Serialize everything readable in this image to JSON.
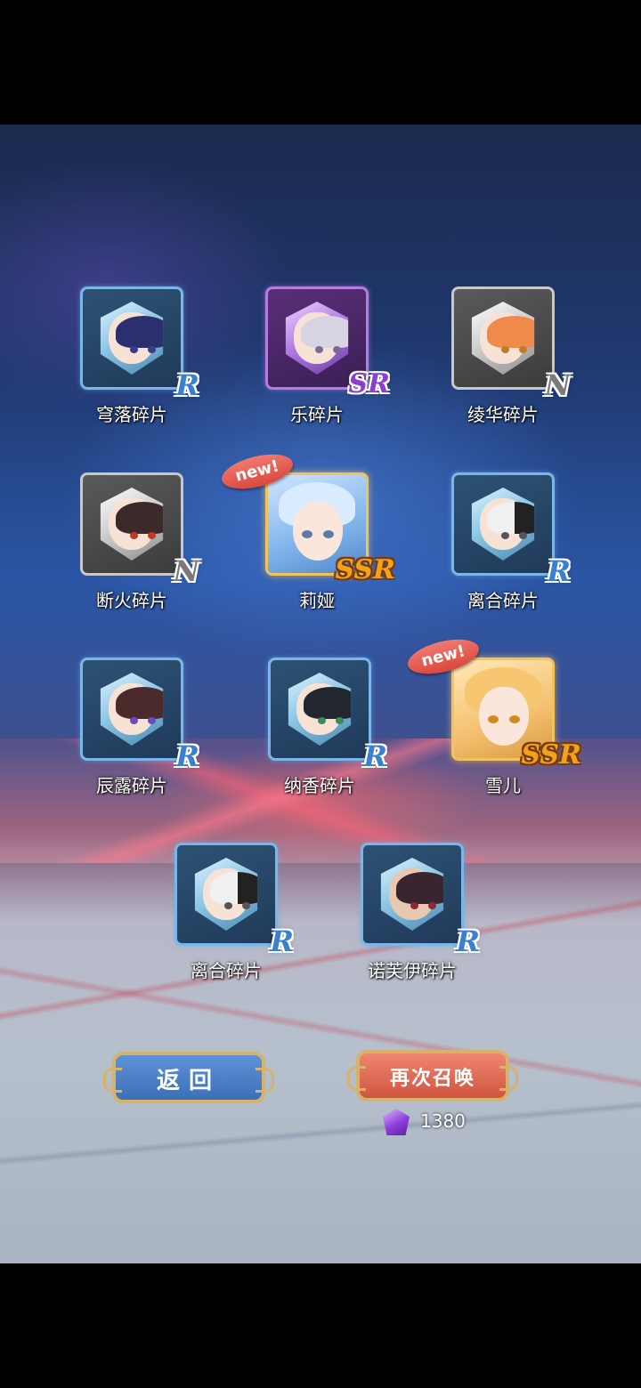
{
  "cards": [
    {
      "id": "c1",
      "label": "穹落碎片",
      "rarity": "R",
      "is_new": false
    },
    {
      "id": "c2",
      "label": "乐碎片",
      "rarity": "SR",
      "is_new": false
    },
    {
      "id": "c3",
      "label": "绫华碎片",
      "rarity": "N",
      "is_new": false
    },
    {
      "id": "c4",
      "label": "断火碎片",
      "rarity": "N",
      "is_new": false
    },
    {
      "id": "c5",
      "label": "莉娅",
      "rarity": "SSR",
      "is_new": true
    },
    {
      "id": "c6",
      "label": "离合碎片",
      "rarity": "R",
      "is_new": false
    },
    {
      "id": "c7",
      "label": "辰露碎片",
      "rarity": "R",
      "is_new": false
    },
    {
      "id": "c8",
      "label": "纳香碎片",
      "rarity": "R",
      "is_new": false
    },
    {
      "id": "c9",
      "label": "雪儿",
      "rarity": "SSR",
      "is_new": true
    },
    {
      "id": "c10",
      "label": "离合碎片",
      "rarity": "R",
      "is_new": false
    },
    {
      "id": "c11",
      "label": "诺芙伊碎片",
      "rarity": "R",
      "is_new": false
    }
  ],
  "new_tag": "new!",
  "buttons": {
    "back_label": "返回",
    "summon_again_label": "再次召唤"
  },
  "cost": {
    "icon": "purple-gem-icon",
    "amount": "1380"
  },
  "colors": {
    "R": "#3a7fd0",
    "SR": "#8b3fd0",
    "N": "#7a7a7a",
    "SSR": "#f0a21c"
  }
}
